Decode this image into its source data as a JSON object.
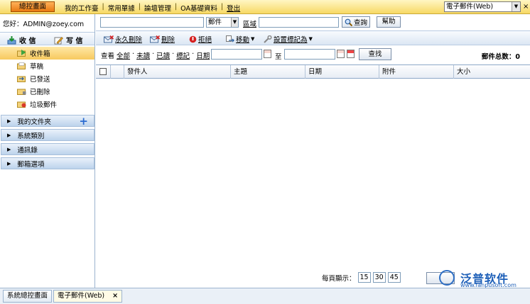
{
  "top_menu": {
    "home_button": "總控畫面",
    "items": [
      "我的工作臺",
      "常用單據",
      "論壇管理",
      "OA基礎資料",
      "登出"
    ],
    "app_select": "電子郵件(Web)",
    "close": "×"
  },
  "sidebar": {
    "greeting": "您好：ADMIN@zoey.com",
    "receive_label": "收 信",
    "compose_label": "写 信",
    "folders": [
      {
        "label": "收件箱",
        "active": true
      },
      {
        "label": "草稿",
        "active": false
      },
      {
        "label": "已發送",
        "active": false
      },
      {
        "label": "已刪除",
        "active": false
      },
      {
        "label": "垃圾郵件",
        "active": false
      }
    ],
    "sections": [
      "我的文件夾",
      "系統類別",
      "通訊錄",
      "郵箱選項"
    ]
  },
  "search": {
    "keyword_value": "",
    "type_value": "郵件",
    "area_label": "區域",
    "area_value": "",
    "query_label": "查詢",
    "help_label": "幫助"
  },
  "toolbar": {
    "perm_delete": "永久刪除",
    "delete": "刪除",
    "reject": "拒絕",
    "move": "移動",
    "mark_as": "設置標記為"
  },
  "filter": {
    "view_label": "查看",
    "options": [
      "全部",
      "未讀",
      "已讀",
      "標記",
      "日期"
    ],
    "date_from": "",
    "to_label": "至",
    "date_to": "",
    "find_label": "查找",
    "total_label": "郵件总数：0"
  },
  "grid": {
    "columns": [
      "發件人",
      "主題",
      "日期",
      "附件",
      "大小"
    ]
  },
  "pager": {
    "per_page_label": "每頁顯示：",
    "sizes": [
      "15",
      "30",
      "45"
    ]
  },
  "watermark": {
    "brand": "泛普软件",
    "url": "www.fanpusoft.com"
  },
  "tabs": [
    {
      "label": "系統總控畫面",
      "active": false
    },
    {
      "label": "電子郵件(Web)",
      "active": true,
      "close": "×"
    }
  ]
}
